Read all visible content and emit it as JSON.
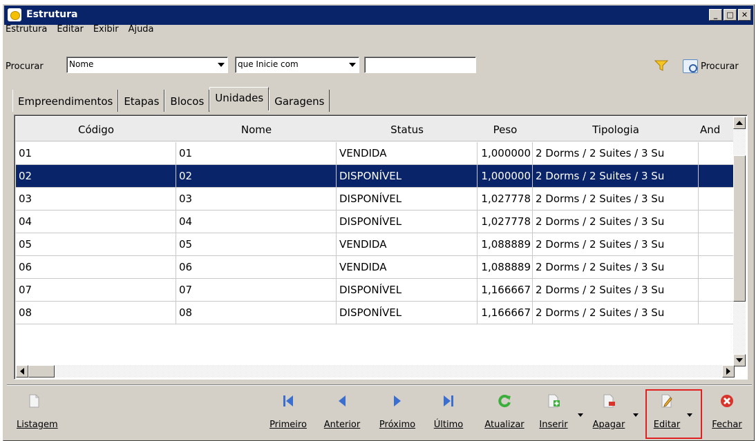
{
  "window": {
    "title": "Estrutura"
  },
  "menu": [
    "Estrutura",
    "Editar",
    "Exibir",
    "Ajuda"
  ],
  "search": {
    "label": "Procurar",
    "field_value": "Nome",
    "mode_value": "que Inicie com",
    "text_value": "",
    "button_label": "Procurar"
  },
  "tabs": [
    "Empreendimentos",
    "Etapas",
    "Blocos",
    "Unidades",
    "Garagens"
  ],
  "active_tab": "Unidades",
  "grid": {
    "columns": [
      "Código",
      "Nome",
      "Status",
      "Peso",
      "Tipologia",
      "And"
    ],
    "rows": [
      [
        "01",
        "01",
        "VENDIDA",
        "1,000000",
        "2 Dorms / 2 Suites / 3 Su",
        ""
      ],
      [
        "02",
        "02",
        "DISPONÍVEL",
        "1,000000",
        "2 Dorms / 2 Suites / 3 Su",
        ""
      ],
      [
        "03",
        "03",
        "DISPONÍVEL",
        "1,027778",
        "2 Dorms / 2 Suites / 3 Su",
        ""
      ],
      [
        "04",
        "04",
        "DISPONÍVEL",
        "1,027778",
        "2 Dorms / 2 Suites / 3 Su",
        ""
      ],
      [
        "05",
        "05",
        "VENDIDA",
        "1,088889",
        "2 Dorms / 2 Suites / 3 Su",
        ""
      ],
      [
        "06",
        "06",
        "VENDIDA",
        "1,088889",
        "2 Dorms / 2 Suites / 3 Su",
        ""
      ],
      [
        "07",
        "07",
        "DISPONÍVEL",
        "1,166667",
        "2 Dorms / 2 Suites / 3 Su",
        ""
      ],
      [
        "08",
        "08",
        "DISPONÍVEL",
        "1,166667",
        "2 Dorms / 2 Suites / 3 Su",
        ""
      ]
    ],
    "selected_row": 1
  },
  "toolbar": {
    "listagem": "Listagem",
    "primeiro": "Primeiro",
    "anterior": "Anterior",
    "proximo": "Próximo",
    "ultimo": "Último",
    "atualizar": "Atualizar",
    "inserir": "Inserir",
    "apagar": "Apagar",
    "editar": "Editar",
    "fechar": "Fechar"
  },
  "colors": {
    "titlebar": "#0a246a",
    "selection": "#0a246a",
    "window_bg": "#d4d0c8",
    "nav_blue": "#3a6fd0",
    "refresh_green": "#3cae3c",
    "close_red": "#d9342b",
    "highlight_box": "#e02020"
  }
}
